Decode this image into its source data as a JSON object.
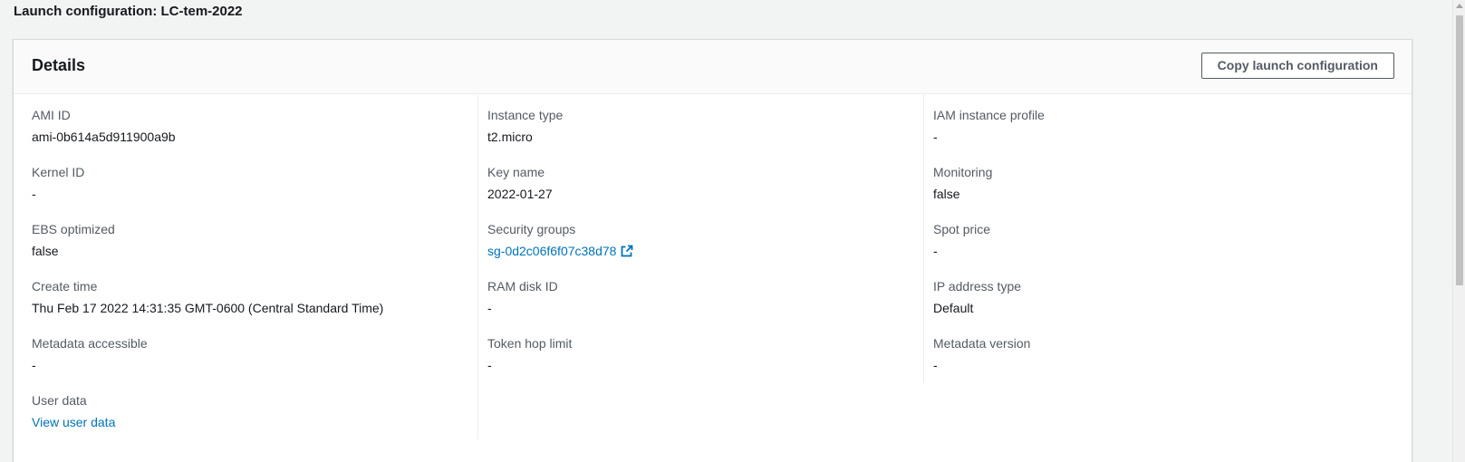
{
  "page": {
    "title": "Launch configuration: LC-tem-2022"
  },
  "details": {
    "title": "Details",
    "copy_button": "Copy launch configuration",
    "columns": [
      [
        {
          "label": "AMI ID",
          "value": "ami-0b614a5d911900a9b"
        },
        {
          "label": "Kernel ID",
          "value": "-"
        },
        {
          "label": "EBS optimized",
          "value": "false"
        },
        {
          "label": "Create time",
          "value": "Thu Feb 17 2022 14:31:35 GMT-0600 (Central Standard Time)"
        },
        {
          "label": "Metadata accessible",
          "value": "-"
        },
        {
          "label": "User data",
          "value": "View user data"
        }
      ],
      [
        {
          "label": "Instance type",
          "value": "t2.micro"
        },
        {
          "label": "Key name",
          "value": "2022-01-27"
        },
        {
          "label": "Security groups",
          "value": "sg-0d2c06f6f07c38d78"
        },
        {
          "label": "RAM disk ID",
          "value": "-"
        },
        {
          "label": "Token hop limit",
          "value": "-"
        }
      ],
      [
        {
          "label": "IAM instance profile",
          "value": "-"
        },
        {
          "label": "Monitoring",
          "value": "false"
        },
        {
          "label": "Spot price",
          "value": "-"
        },
        {
          "label": "IP address type",
          "value": "Default"
        },
        {
          "label": "Metadata version",
          "value": "-"
        }
      ]
    ]
  },
  "colors": {
    "link": "#0073bb",
    "label": "#545b64",
    "text": "#16191f",
    "background": "#f2f3f3"
  },
  "icons": {
    "external_link": "external-link-icon"
  }
}
